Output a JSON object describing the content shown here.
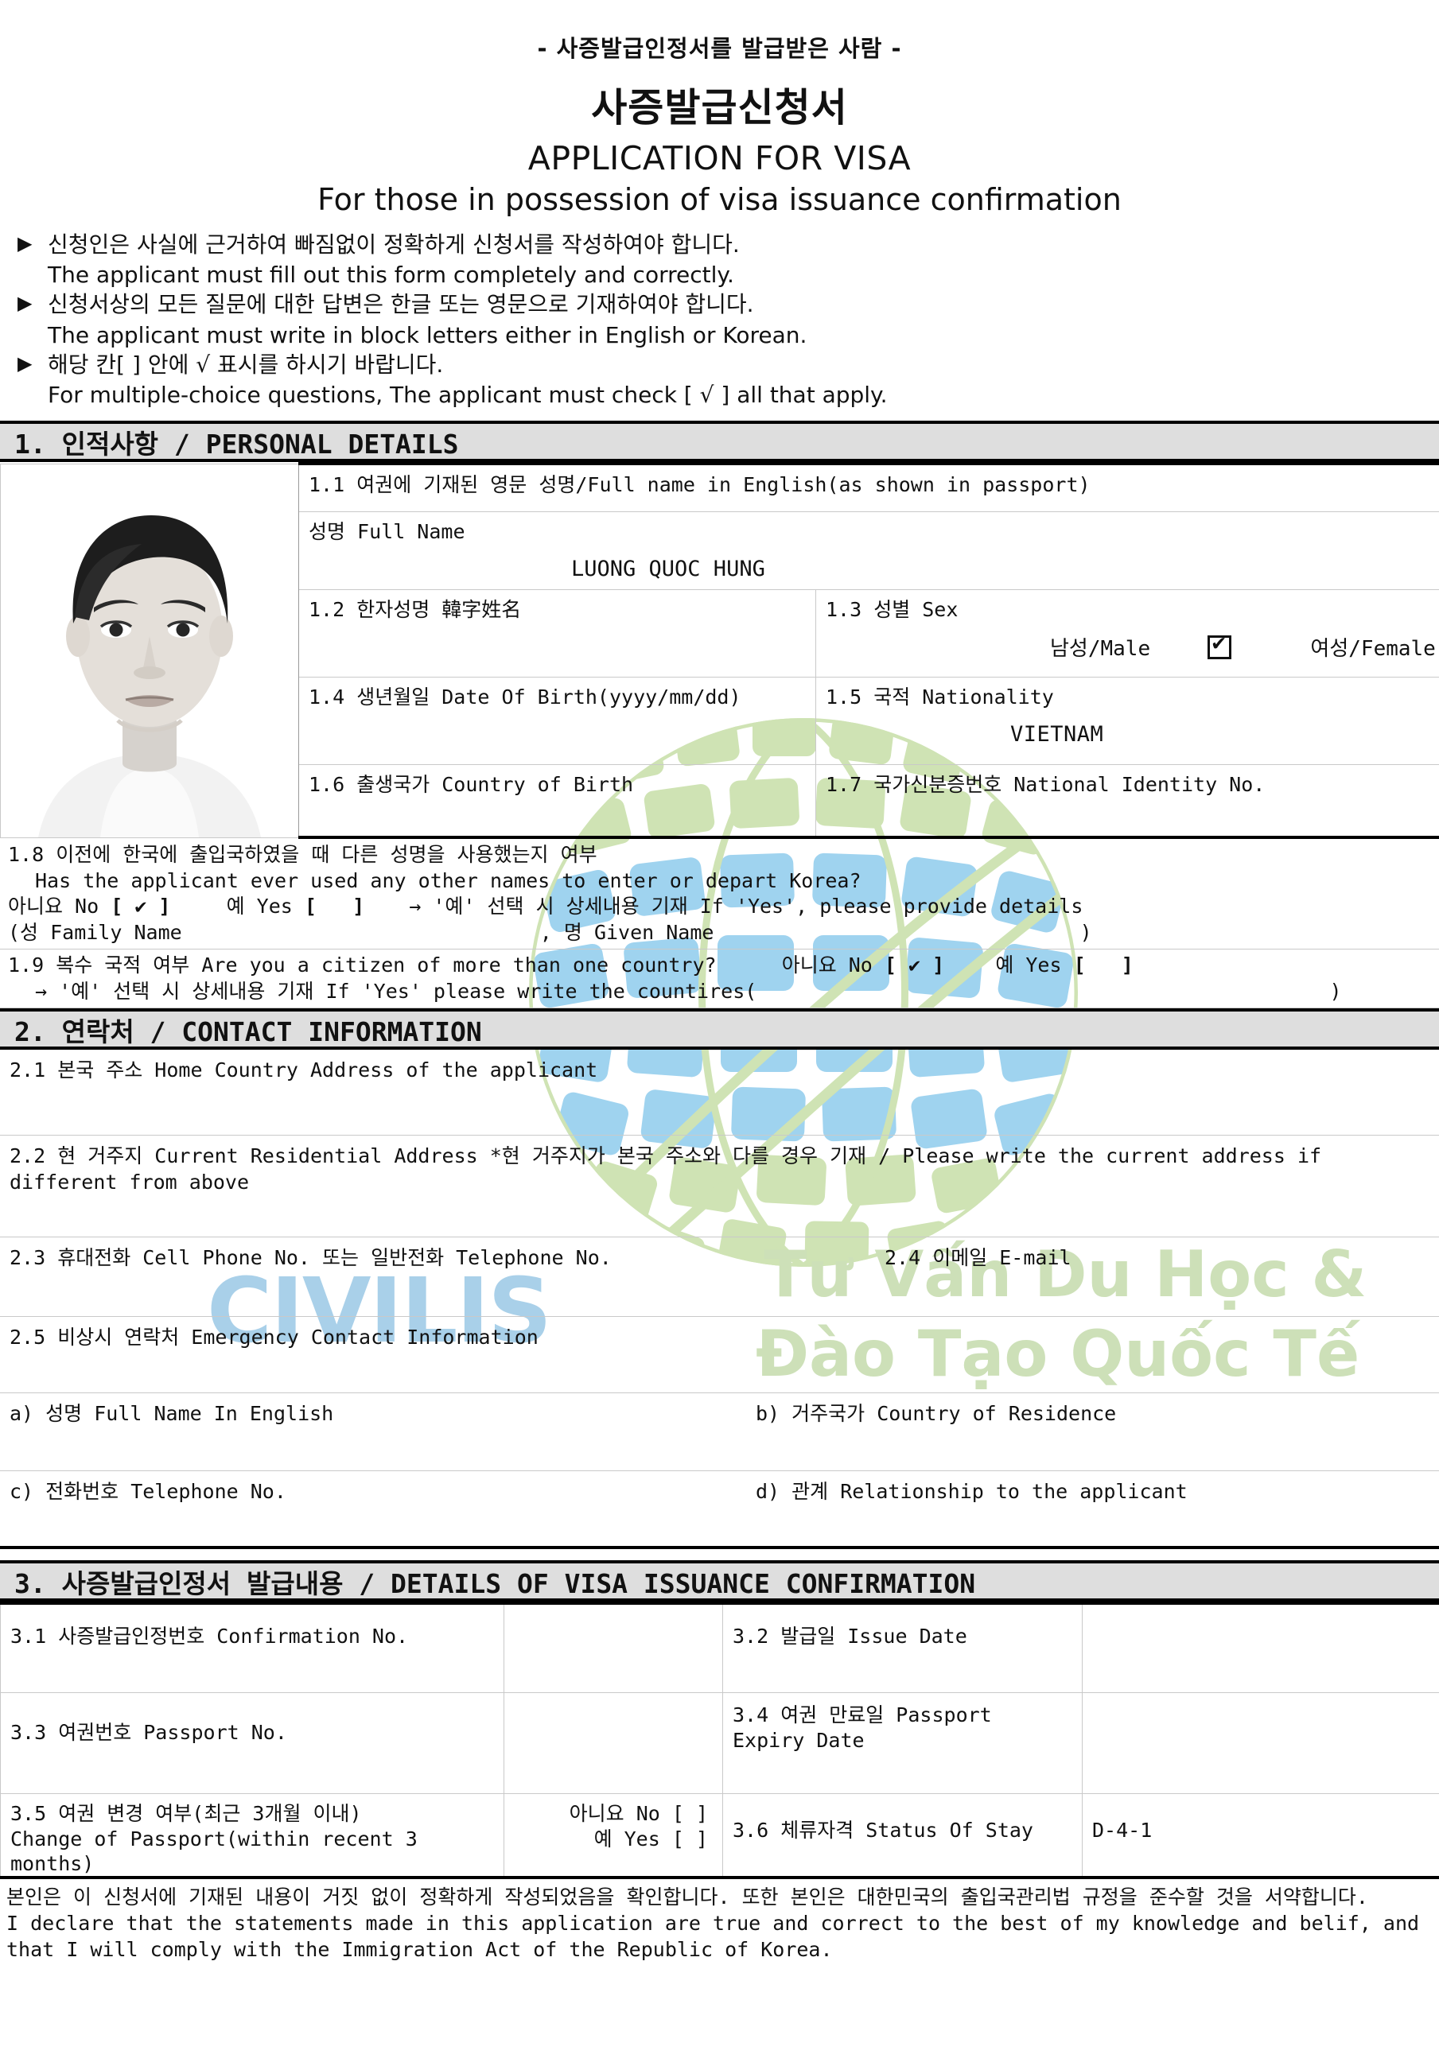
{
  "header": {
    "sub_top": "- 사증발급인정서를 발급받은 사람 -",
    "title_kr": "사증발급신청서",
    "title_en": "APPLICATION FOR VISA",
    "subtitle_en": "For those in possession of visa issuance confirmation"
  },
  "instructions": [
    {
      "bullet": "▶",
      "kr": "신청인은 사실에 근거하여 빠짐없이 정확하게 신청서를 작성하여야 합니다.",
      "en": "The applicant must fill out this form completely and correctly."
    },
    {
      "bullet": "▶",
      "kr": "신청서상의 모든 질문에 대한 답변은 한글 또는 영문으로 기재하여야 합니다.",
      "en": "The applicant must write in block letters either in English or Korean."
    },
    {
      "bullet": "▶",
      "kr": "해당 칸[ ] 안에 √ 표시를 하시기 바랍니다.",
      "en": "For multiple-choice questions, The applicant must check [ √ ] all that apply."
    }
  ],
  "sections": {
    "personal": "1. 인적사항 / PERSONAL DETAILS",
    "contact": "2. 연락처 / CONTACT INFORMATION",
    "visa_confirmation": "3. 사증발급인정서 발급내용 / DETAILS OF VISA ISSUANCE CONFIRMATION"
  },
  "personal": {
    "photo_alt": "applicant-passport-photo",
    "f11_label": "1.1 여권에 기재된 영문 성명/Full name in English(as shown in passport)",
    "full_name_label": "성명 Full Name",
    "full_name_value": "LUONG QUOC HUNG",
    "f12_label": "1.2 한자성명 韓字姓名",
    "f12_value": "",
    "f13_label": "1.3 성별 Sex",
    "male_label": "남성/Male",
    "female_label": "여성/Female",
    "male_checked": "✔",
    "female_checked": "",
    "f14_label": "1.4 생년월일 Date Of Birth(yyyy/mm/dd)",
    "f14_value": "",
    "f15_label": "1.5 국적 Nationality",
    "f15_value": "VIETNAM",
    "f16_label": "1.6 출생국가 Country of Birth",
    "f16_value": "",
    "f17_label": "1.7 국가신분증번호 National Identity No.",
    "f17_value": "",
    "f18": {
      "kr": "1.8 이전에 한국에 출입국하였을 때 다른 성명을 사용했는지 여부",
      "en": "Has the applicant ever used any other names to enter or depart Korea?",
      "no_label": "아니요 No",
      "no_mark": "✔",
      "yes_label": "예 Yes",
      "yes_mark": "",
      "arrow_note": "→ '예' 선택 시 상세내용 기재 If 'Yes', please provide details",
      "detail_line": "(성 Family Name",
      "detail_line2": ", 명 Given Name",
      "detail_close": ")"
    },
    "f19": {
      "kr_en": "1.9 복수 국적 여부 Are you a citizen of more than one country?",
      "no_label": "아니요 No",
      "no_mark": "✔",
      "yes_label": "예 Yes",
      "yes_mark": "",
      "detail": "→ '예' 선택 시 상세내용 기재 If 'Yes' please write the countires(",
      "detail_close": ")"
    }
  },
  "contact": {
    "f21_label": "2.1 본국 주소 Home Country Address of the applicant",
    "f21_value": "",
    "f22_label": "2.2 현 거주지 Current Residential Address *현 거주지가 본국 주소와 다를 경우 기재 / Please write the current address if different from above",
    "f22_value": "",
    "f23_label": "2.3 휴대전화 Cell Phone No. 또는 일반전화 Telephone No.",
    "f23_value": "",
    "f24_label": "2.4 이메일 E-mail",
    "f24_value": "",
    "f25_label": "2.5 비상시 연락처 Emergency Contact Information",
    "f25a_label": "a) 성명 Full Name In English",
    "f25a_value": "",
    "f25b_label": "b) 거주국가 Country of Residence",
    "f25b_value": "",
    "f25c_label": "c) 전화번호 Telephone No.",
    "f25c_value": "",
    "f25d_label": "d) 관계 Relationship to the applicant",
    "f25d_value": ""
  },
  "visa": {
    "f31_label": "3.1 사증발급인정번호 Confirmation No.",
    "f31_value": "",
    "f32_label": "3.2 발급일 Issue Date",
    "f32_value": "",
    "f33_label": "3.3 여권번호 Passport No.",
    "f33_value": "",
    "f34_label": "3.4 여권 만료일 Passport Expiry Date",
    "f34_value": "",
    "f35_label_kr": "3.5 여권 변경 여부(최근 3개월 이내)",
    "f35_label_en": "Change of Passport(within recent 3 months)",
    "f35_no": "아니요 No [   ]",
    "f35_yes": "예 Yes [   ]",
    "f36_label": "3.6 체류자격 Status Of Stay",
    "f36_value": "D-4-1"
  },
  "declaration": {
    "kr": "본인은 이 신청서에 기재된 내용이 거짓 없이 정확하게 작성되었음을 확인합니다. 또한 본인은 대한민국의 출입국관리법 규정을 준수할 것을 서약합니다.",
    "en": "I declare that the statements made in this application are true and correct to the best of my knowledge and belif, and that I will comply with the Immigration Act of the Republic of Korea."
  },
  "watermark": {
    "brand": "CIVILIS",
    "line1": "Tư Vấn Du Học &",
    "line2": "Đào Tạo Quốc Tế",
    "brand_color": "#a9d0e9",
    "text_color": "#cde0b8",
    "globe_blue": "#9fd3ef",
    "globe_green": "#cfe3b4"
  }
}
